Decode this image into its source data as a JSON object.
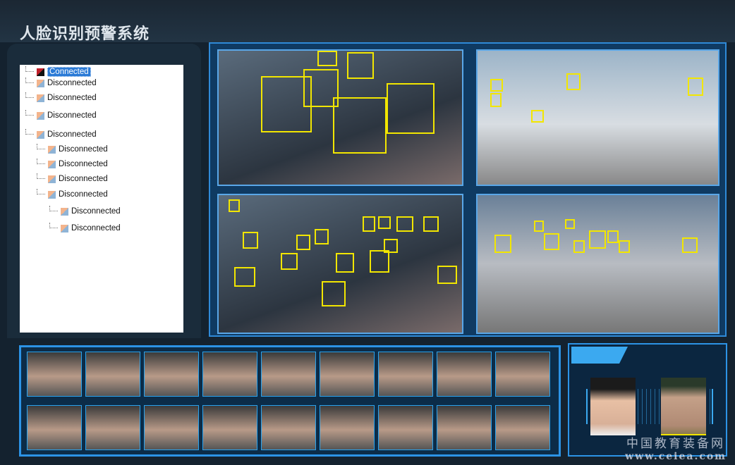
{
  "header": {
    "title": "人脸识别预警系统"
  },
  "tree": [
    {
      "label": "Connected",
      "status": "connected",
      "level": 0
    },
    {
      "label": "Disconnected",
      "status": "disconnected",
      "level": 0
    },
    {
      "label": "Disconnected",
      "status": "disconnected",
      "level": 0
    },
    {
      "label": "Disconnected",
      "status": "disconnected",
      "level": 0
    },
    {
      "label": "Disconnected",
      "status": "disconnected",
      "level": 0
    },
    {
      "label": "Disconnected",
      "status": "disconnected",
      "level": 1
    },
    {
      "label": "Disconnected",
      "status": "disconnected",
      "level": 1
    },
    {
      "label": "Disconnected",
      "status": "disconnected",
      "level": 1
    },
    {
      "label": "Disconnected",
      "status": "disconnected",
      "level": 1
    },
    {
      "label": "Disconnected",
      "status": "disconnected",
      "level": 2
    },
    {
      "label": "Disconnected",
      "status": "disconnected",
      "level": 2
    }
  ],
  "watermark": {
    "cn": "中国教育装备网",
    "url": "www.ceiea.com"
  },
  "colors": {
    "face_box": "#f2e600",
    "accent": "#2c93e6"
  }
}
